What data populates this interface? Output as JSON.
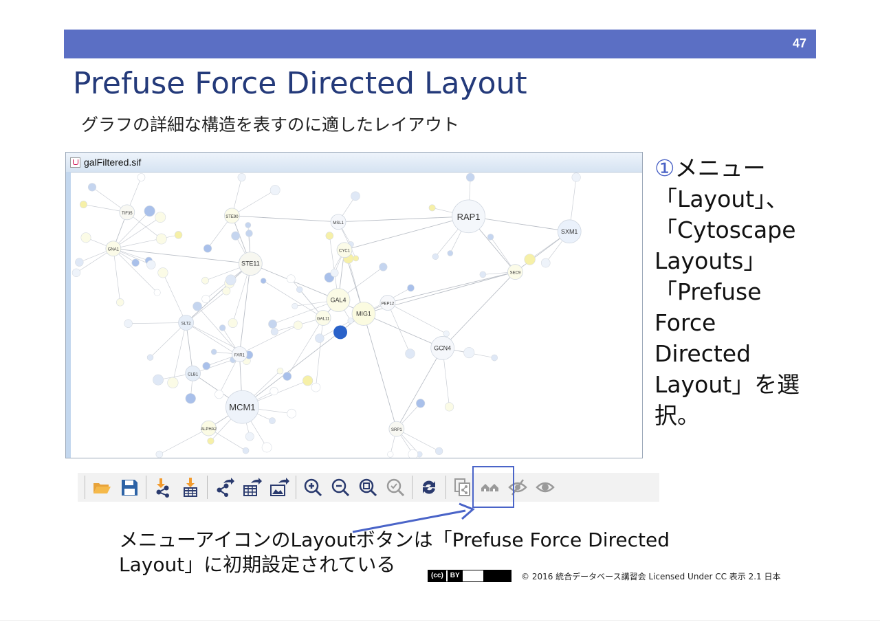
{
  "slide": {
    "number": "47",
    "title": "Prefuse Force Directed Layout",
    "subtitle": "グラフの詳細な構造を表すのに適したレイアウト"
  },
  "window": {
    "title": "galFiltered.sif"
  },
  "network": {
    "nodes": [
      {
        "label": "RAP1",
        "size": "large",
        "color": "#f4f7fb"
      },
      {
        "label": "MCM1",
        "size": "large",
        "color": "#eef3fa"
      },
      {
        "label": "GAL4",
        "size": "medium",
        "color": "#fbfbe6"
      },
      {
        "label": "MIG1",
        "size": "medium",
        "color": "#fbfbe0"
      },
      {
        "label": "STE11",
        "size": "medium",
        "color": "#f7f7f0"
      },
      {
        "label": "SXM1",
        "size": "medium",
        "color": "#eaf1fb"
      },
      {
        "label": "GCN4",
        "size": "medium",
        "color": "#f5f7fb"
      },
      {
        "label": "PEP12",
        "size": "small",
        "color": "#f7f8fb"
      },
      {
        "label": "SLT2",
        "size": "small",
        "color": "#e6eef8"
      },
      {
        "label": "GNA1",
        "size": "small",
        "color": "#fbfbe8"
      },
      {
        "label": "CYC1",
        "size": "small",
        "color": "#fbfbe8"
      },
      {
        "label": "SEC9",
        "size": "small",
        "color": "#fbfbe8"
      },
      {
        "label": "ALPHA2",
        "size": "small",
        "color": "#fbfbe4"
      },
      {
        "label": "SRP1",
        "size": "small",
        "color": "#f8f8f2"
      },
      {
        "label": "GAL11",
        "size": "small",
        "color": "#fbfbe8"
      },
      {
        "label": "STE90",
        "size": "small",
        "color": "#fbfbe8"
      },
      {
        "label": "MSL1",
        "size": "small",
        "color": "#f5f7fb"
      },
      {
        "label": "CLB1",
        "size": "small",
        "color": "#e6eef8"
      },
      {
        "label": "TIF35",
        "size": "small",
        "color": "#f8f8f2"
      },
      {
        "label": "FAR1",
        "size": "small",
        "color": "#f5f7fb"
      }
    ]
  },
  "instructions": {
    "number": "①",
    "text": "メニュー「Layout」、「Cytoscape Layouts」「Prefuse Force Directed Layout」を選択。"
  },
  "toolbar": {
    "buttons": [
      {
        "icon": "open-folder-icon"
      },
      {
        "icon": "save-icon"
      },
      {
        "icon": "import-network-icon"
      },
      {
        "icon": "import-table-icon"
      },
      {
        "icon": "export-network-icon"
      },
      {
        "icon": "export-table-icon"
      },
      {
        "icon": "export-image-icon"
      },
      {
        "icon": "zoom-in-icon"
      },
      {
        "icon": "zoom-out-icon"
      },
      {
        "icon": "zoom-fit-icon"
      },
      {
        "icon": "zoom-selected-icon"
      },
      {
        "icon": "apply-layout-icon"
      },
      {
        "icon": "new-network-from-selection-icon"
      },
      {
        "icon": "first-neighbors-icon"
      },
      {
        "icon": "hide-selected-icon"
      },
      {
        "icon": "show-all-icon"
      }
    ]
  },
  "caption": {
    "line1": "メニューアイコンのLayoutボタンは「Prefuse Force Directed",
    "line2": "Layout」に初期設定されている"
  },
  "license": {
    "badge_cc": "(cc)",
    "badge_by": "BY",
    "text": "© 2016  統合データベース講習会 Licensed Under CC 表示 2.1 日本"
  },
  "colors": {
    "accent_bar": "#5b6fc4",
    "title": "#243a7a",
    "highlight": "#4a64c8"
  }
}
